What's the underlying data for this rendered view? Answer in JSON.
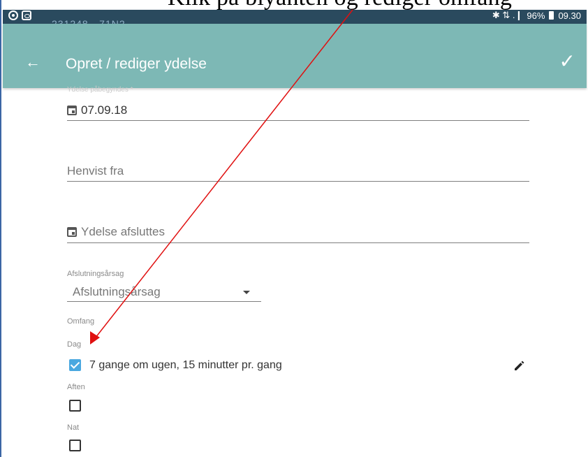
{
  "caption": "Klik på blyanten og rediger omfang",
  "status_bar": {
    "sub_text": "231248 - 71N2",
    "indicators": "✱ ⇅ .❙",
    "battery": "96%",
    "time": "09.30"
  },
  "app_bar": {
    "title": "Opret / rediger ydelse",
    "back_icon": "arrow-left-icon",
    "confirm_icon": "check-icon"
  },
  "form": {
    "start": {
      "label": "Ydelse påbegyndes *",
      "value": "07.09.18"
    },
    "referred_from": {
      "placeholder": "Henvist fra"
    },
    "end": {
      "placeholder": "Ydelse afsluttes"
    },
    "end_reason": {
      "label": "Afslutningsårsag",
      "selected": "Afslutningsårsag"
    },
    "scope": {
      "label": "Omfang",
      "day": {
        "label": "Dag",
        "checked": true,
        "text": "7 gange om ugen, 15 minutter pr. gang"
      },
      "evening": {
        "label": "Aften",
        "checked": false
      },
      "night": {
        "label": "Nat",
        "checked": false
      }
    }
  },
  "colors": {
    "app_bar": "#7db8b5",
    "status_bar": "#2a4a5e",
    "checkbox_checked": "#4aa8e0",
    "annotation": "#e01010"
  }
}
